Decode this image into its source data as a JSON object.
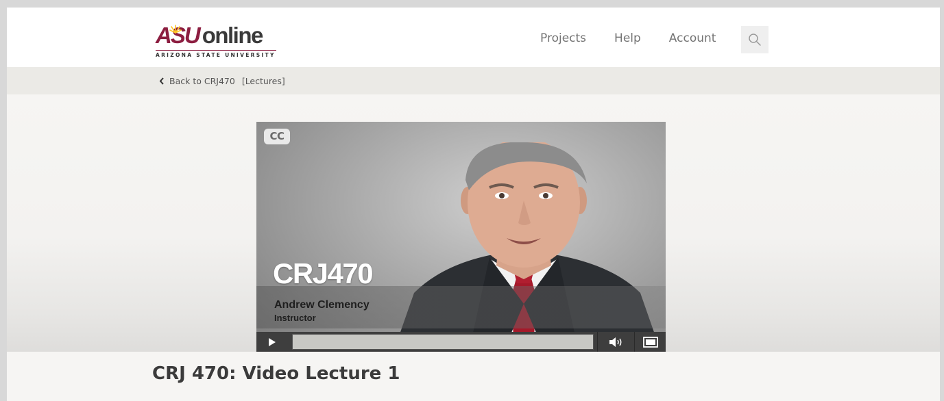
{
  "brand": {
    "logo_primary": "ASU",
    "logo_secondary": "online",
    "logo_subtitle": "ARIZONA STATE UNIVERSITY",
    "color_maroon": "#8c1d40",
    "color_gold": "#ffc627"
  },
  "nav": {
    "items": [
      {
        "label": "Projects"
      },
      {
        "label": "Help"
      },
      {
        "label": "Account"
      }
    ],
    "search_icon": "search-icon"
  },
  "breadcrumb": {
    "back_label": "Back to CRJ470",
    "section_label": "[Lectures]"
  },
  "video": {
    "cc_label": "CC",
    "overlay_title": "CRJ470",
    "instructor_name": "Andrew Clemency",
    "instructor_role": "Instructor",
    "progress": 0.0
  },
  "lecture": {
    "title": "CRJ 470: Video Lecture 1"
  }
}
